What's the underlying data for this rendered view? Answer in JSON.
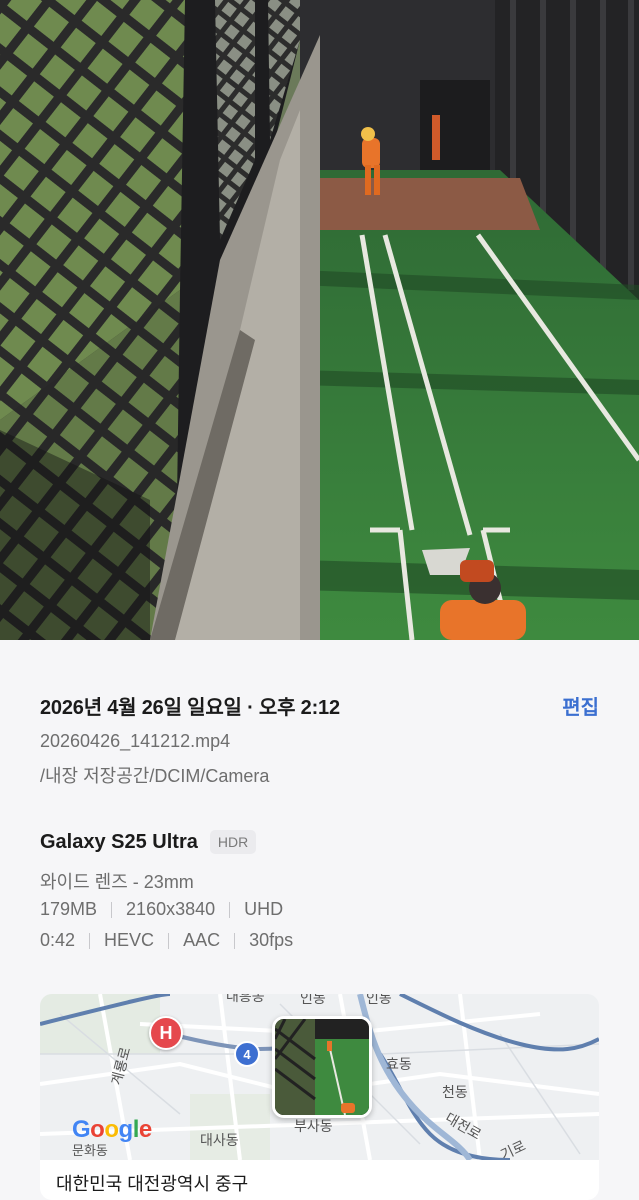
{
  "info": {
    "date_title": "2026년 4월 26일 일요일 · 오후 2:12",
    "edit_label": "편집",
    "file_name": "20260426_141212.mp4",
    "file_path": "/내장 저장공간/DCIM/Camera"
  },
  "device": {
    "name": "Galaxy S25 Ultra",
    "badge": "HDR",
    "lens": "와이드 렌즈 - 23mm",
    "specs_row1": [
      "179MB",
      "2160x3840",
      "UHD"
    ],
    "specs_row2": [
      "0:42",
      "HEVC",
      "AAC",
      "30fps"
    ]
  },
  "map": {
    "hospital_pin": "H",
    "route_number": "4",
    "google_logo": [
      "G",
      "o",
      "o",
      "g",
      "l",
      "e"
    ],
    "labels": {
      "road_left": "계룡로",
      "munhwa": "문화동",
      "daesa": "대사동",
      "busa": "부사동",
      "hyo": "효동",
      "cheon": "천동",
      "daejeon_ro": "대전로",
      "giro": "기로",
      "top_left": "대흥동",
      "top_mid": "인동",
      "top_right": "인동"
    },
    "address": "대한민국 대전광역시 중구"
  }
}
